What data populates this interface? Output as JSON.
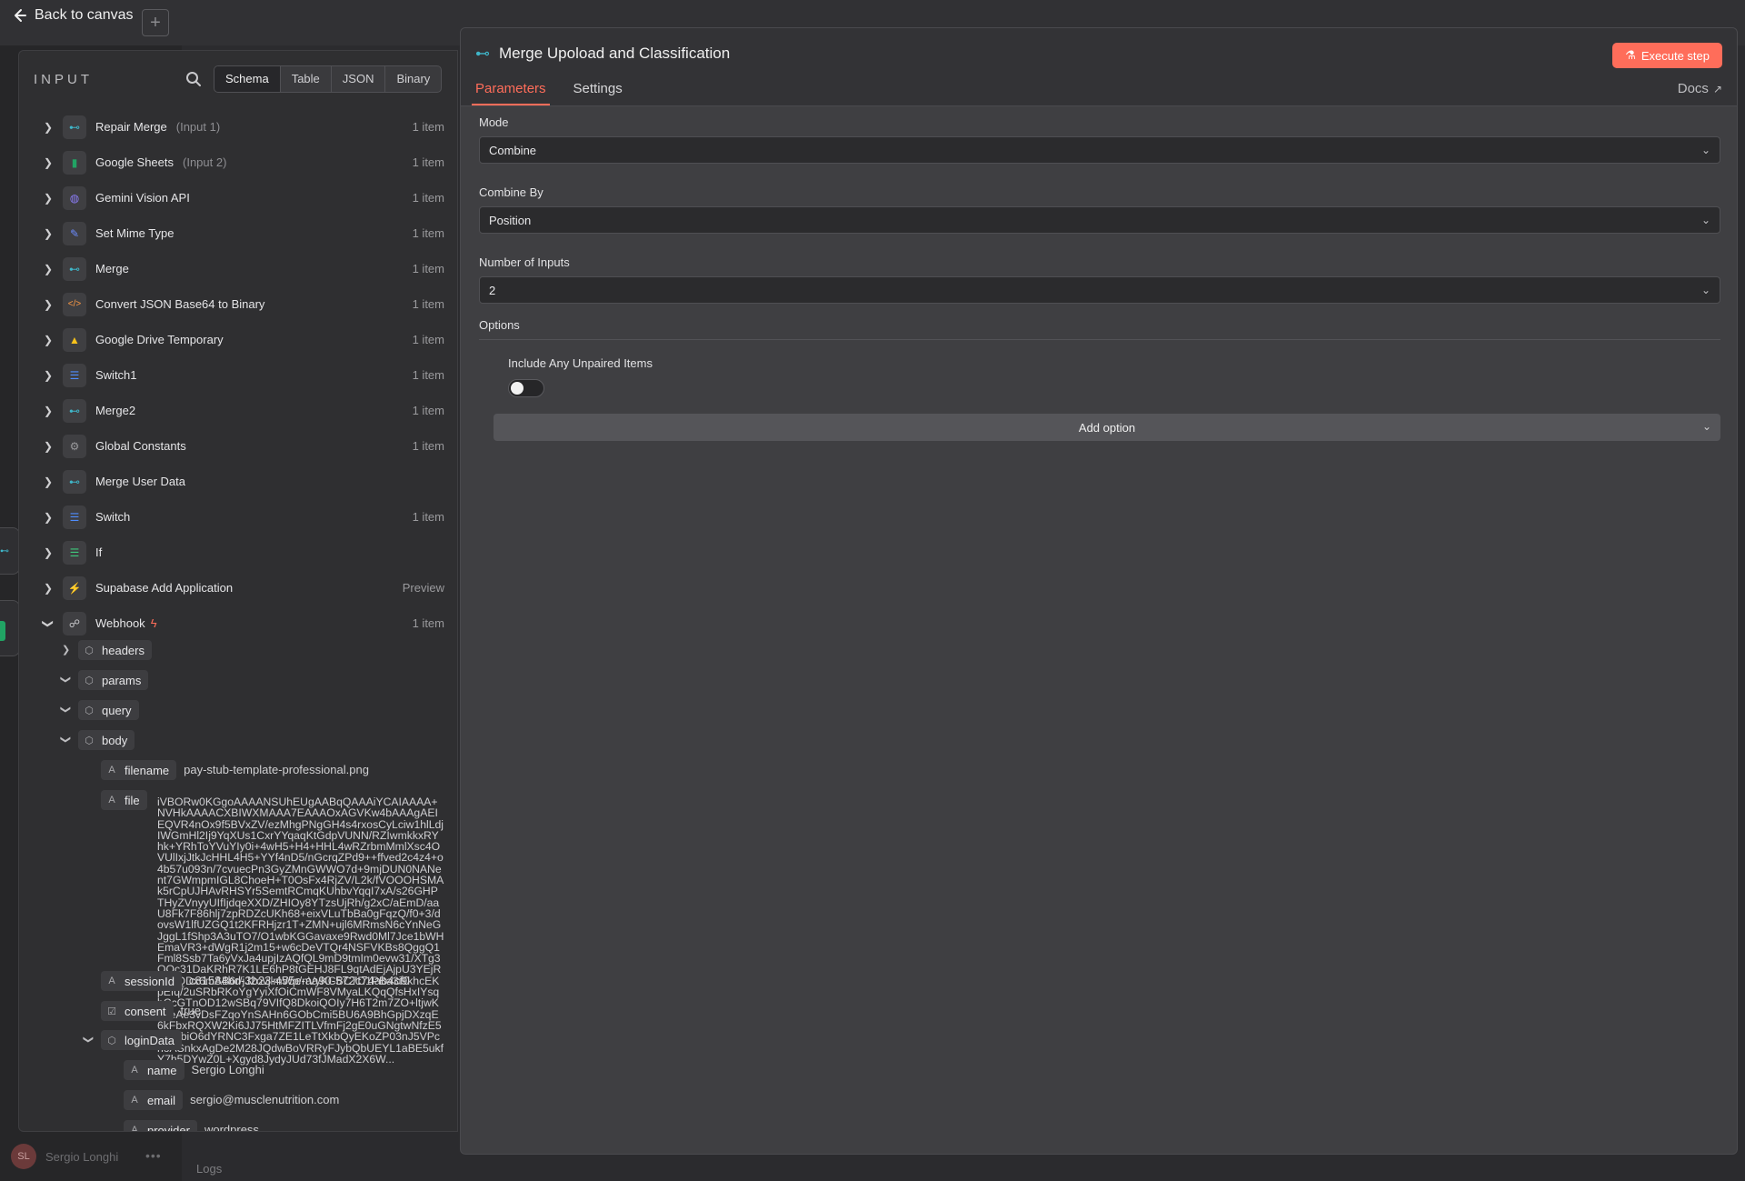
{
  "canvas": {
    "back_label": "Back to canvas",
    "user_name": "Sergio Longhi",
    "user_initials": "SL",
    "logs_label": "Logs"
  },
  "input_panel": {
    "title": "INPUT",
    "view_tabs": [
      "Schema",
      "Table",
      "JSON",
      "Binary"
    ],
    "active_view": "Schema",
    "nodes": [
      {
        "label": "Repair Merge",
        "sub": "(Input 1)",
        "count": "1 item",
        "icon": "merge-icon",
        "color": "#3fb6c9"
      },
      {
        "label": "Google Sheets",
        "sub": "(Input 2)",
        "count": "1 item",
        "icon": "sheets-icon",
        "color": "#21a464"
      },
      {
        "label": "Gemini Vision API",
        "sub": "",
        "count": "1 item",
        "icon": "globe-icon",
        "color": "#8b7cf6"
      },
      {
        "label": "Set Mime Type",
        "sub": "",
        "count": "1 item",
        "icon": "pencil-icon",
        "color": "#6c8cff"
      },
      {
        "label": "Merge",
        "sub": "",
        "count": "1 item",
        "icon": "merge-icon",
        "color": "#3fb6c9"
      },
      {
        "label": "Convert JSON Base64 to Binary",
        "sub": "",
        "count": "1 item",
        "icon": "code-icon",
        "color": "#ff9b45"
      },
      {
        "label": "Google Drive Temporary",
        "sub": "",
        "count": "1 item",
        "icon": "drive-icon",
        "color": "#f7c21b"
      },
      {
        "label": "Switch1",
        "sub": "",
        "count": "1 item",
        "icon": "switch-icon",
        "color": "#4f8dff"
      },
      {
        "label": "Merge2",
        "sub": "",
        "count": "1 item",
        "icon": "merge-icon",
        "color": "#3fb6c9"
      },
      {
        "label": "Global Constants",
        "sub": "",
        "count": "1 item",
        "icon": "gear-icon",
        "color": "#9a9a9d"
      },
      {
        "label": "Merge User Data",
        "sub": "",
        "count": "",
        "icon": "merge-icon",
        "color": "#3fb6c9"
      },
      {
        "label": "Switch",
        "sub": "",
        "count": "1 item",
        "icon": "switch-icon",
        "color": "#4f8dff"
      },
      {
        "label": "If",
        "sub": "",
        "count": "",
        "icon": "if-icon",
        "color": "#3fc77b"
      },
      {
        "label": "Supabase Add Application",
        "sub": "",
        "count": "Preview",
        "icon": "supabase-icon",
        "color": "#3ecf8e"
      },
      {
        "label": "Webhook",
        "sub": "",
        "count": "1 item",
        "icon": "webhook-icon",
        "color": "#c9c9cc"
      }
    ],
    "webhook_fields": {
      "headers": "headers",
      "params": "params",
      "query": "query",
      "body": "body",
      "filename_key": "filename",
      "filename_value": "pay-stub-template-professional.png",
      "file_key": "file",
      "file_value": "iVBORw0KGgoAAAANSUhEUgAABqQAAAiYCAIAAAA+NVHkAAAACXBIWXMAAA7EAAAOxAGVKw4bAAAgAEIEQVR4nOx9f5BVxZV/ezMhgPNgGH4s4rxosCyLciw1hlLdjIWGmHl2Ij9YqXUs1CxrYYqaqKtGdpVUNN/RZIwmkkxRYhk+YRhToYVuYIy0i+4wH5+H4+HHL4wRZrbmMmlXsc4OVUlIxjJtkJcHHL4H5+YYf4nD5/nGcrqZPd9++ffved2c4z4+o4b57u093n/7cvuecPn3GyZMnGWWO7d+9mjDUN0NANent7GWmpmIGL8ChoeH+T0OsFx4RjZV/L2k/fVOOOHSMAk5rCpUJHAvRHSYr5SemtRCmqKUhbvYqqI7xA/s26GHPTHyZVnyyUIfIjdqeXXD/ZHIOy8YTzsUjRh/g2xC/aEmD/aaU8Fk7F86hlj7zpRDZcUKh68+eixVLuTbBa0gFqzQ/f0+3/dovsW1lfUZGQ1t2KFRHjzr1T+ZMN+ujl6MRmsN6cYnNeGJggL1fShp3A3uTO7/O1wbKGGavaxe9Rwd0Ml7Jce1bWHEmaVR3+dWgR1j2m15+w6cDeVTQr4NSFVKBs8QggQ1Fml8Ssb7Ta6yVxJa4upjIzAQfQL9mD9tmIm0evw31/XTg3OOc31DaKRhR7K1LE6hP8tGEHJ8FL9qtAdEjAjpU3YEjRcjz1QDx6mAB6r/jJ2ovjlmWp/nVyKCBC7D1PBa3i9khcEKpEfq/2uSRbRKoYgYyiXfOiCmWF8VMyaLKQqQfsHxIYsqbCcGTnOD12wSBq79VIfQ8DkoiQOIy7H6T2m7ZO+ltjwKhdeAe3vDsFZqoYnSAHn6GObCmi5BU6A9BhGpjDXzqE6kFbxRQXW2Ki6JJ75HtMFZITLVfmFj2gE0uGNgtwNfzE5aIkGbiO6dYRNC3Fxga7ZE1LeTtXkbQyEKoZP03nJ5VPchoASnkxAgDe2M28JQdwBoVRRyFJybQbUEYL1aBE5ukfY7h5DYwZ0L+Xgyd8JydyJUd73fJMadX2X6W",
      "file_display": "iVBORw0KGgoAAAANSUhEUgAABqQAAAiYCAIAAAA+NVHkAAAACXBIWXMAAA7EAAAOxAGVKw4bAAAgAEIEQVR4nOx9f5BVxZV/ezMhgPNgGH4s4rxosCyLciw1hlLdjIWGmHl2Ij9YqXUs1CxrYYqaqKtGdpVUNN/RZIwmkkxRYhk+YRhToYVuYIy0i+4wH5+H4+HHL4wRZrbmMmlXsc4OVUlIxjJtkJcHHL4H5+YYf4nD5/nGcrqZPd9++ffved2c4z4+o4b57u093n/7cvuecPn3GyZMnGWWO7d+9mjDUN0NANent7GWmpmIGL8ChoeH+T0OsFx4RjZV/L2k/fVOOOHSMAk5rCpUJHAvRHSYr5SemtRCmqKUhbvYqqI7xA/s26GHPTHyZVnyyUIfIjdqeXXD/ZHIOy8YTzsUjRh/g2xC/aEmD/aaU8Fk7F86hlj7zpRDZcUKh68+eixVLuTbBa0gFqzQ/f0+3/dovsW1lfUZGQ1t2KFRHjzr1T+ZMN+ujl6MRmsN6cYnNeGJggL1fShp3A3uTO7/O1wbKGGavaxe9Rwd0Ml7Jce1bWHEmaVR3+dWgR1j2m15+w6cDeVTQr4NSFVKBs8QggQ1Fml8Ssb7Ta6yVxJa4upjIzAQfQL9mD9tmIm0evw31/XTg3OOc31DaKRhR7K1LE6hP8tGEHJ8FL9qtAdEjAjpU3YEjRcjz1QDx6mAB6r/jJ2ovjlmWp/nVyKCBC7D1PBa3i9khcEKpEfq/2uSRbRKoYgYyiXfOiCmWF8VMyaLKQqQfsHxIYsqbCcGTnOD12wSBq79VIfQ8DkoiQOIy7H6T2m7ZO+ltjwKhdeAe3vDsFZqoYnSAHn6GObCmi5BU6A9BhGpjDXzqE6kFbxRQXW2Ki6JJ75HtMFZITLVfmFj2gE0uGNgtwNfzE5aIkGbiO6dYRNC3Fxga7ZE1LeTtXkbQyEKoZP03nJ5VPchoASnkxAgDe2M28JQdwBoVRRyFJybQbUEYL1aBE5ukfY7h5DYwZ0L+Xgyd8JydyJUd73fJMadX2X6W...",
      "session_key": "sessionId",
      "session_value": "c81584bd-3b23-455e-aa90-572c74ab4cf0",
      "consent_key": "consent",
      "consent_value": "true",
      "login_key": "loginData",
      "name_key": "name",
      "name_value": "Sergio Longhi",
      "email_key": "email",
      "email_value": "sergio@musclenutrition.com",
      "provider_key": "provider",
      "provider_value": "wordpress"
    }
  },
  "node_panel": {
    "title": "Merge Upoload and Classification",
    "execute_label": "Execute step",
    "tabs": [
      "Parameters",
      "Settings"
    ],
    "active_tab": "Parameters",
    "docs_label": "Docs",
    "mode_label": "Mode",
    "mode_value": "Combine",
    "combine_by_label": "Combine By",
    "combine_by_value": "Position",
    "num_inputs_label": "Number of Inputs",
    "num_inputs_value": "2",
    "options_label": "Options",
    "include_unpaired_label": "Include Any Unpaired Items",
    "include_unpaired_on": false,
    "add_option_label": "Add option"
  },
  "colors": {
    "accent": "#ff6d5a",
    "panel_bg": "#3f3f42",
    "merge_icon": "#3fb6c9"
  }
}
